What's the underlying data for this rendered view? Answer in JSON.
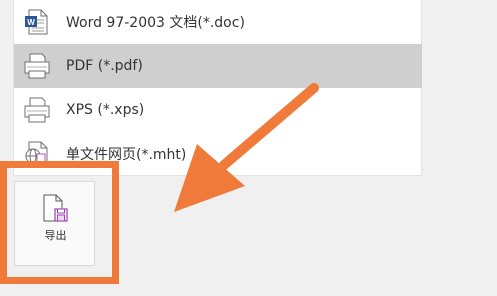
{
  "menu": {
    "items": [
      {
        "label": "Word 97-2003 文档(*.doc)",
        "icon": "word-doc-icon",
        "selected": false
      },
      {
        "label": "PDF (*.pdf)",
        "icon": "printer-icon",
        "selected": true
      },
      {
        "label": "XPS (*.xps)",
        "icon": "printer-icon",
        "selected": false
      },
      {
        "label": "单文件网页(*.mht)",
        "icon": "web-page-icon",
        "selected": false
      }
    ]
  },
  "export": {
    "label": "导出",
    "icon": "export-document-icon"
  },
  "annotation": {
    "color": "#f07a3a"
  }
}
